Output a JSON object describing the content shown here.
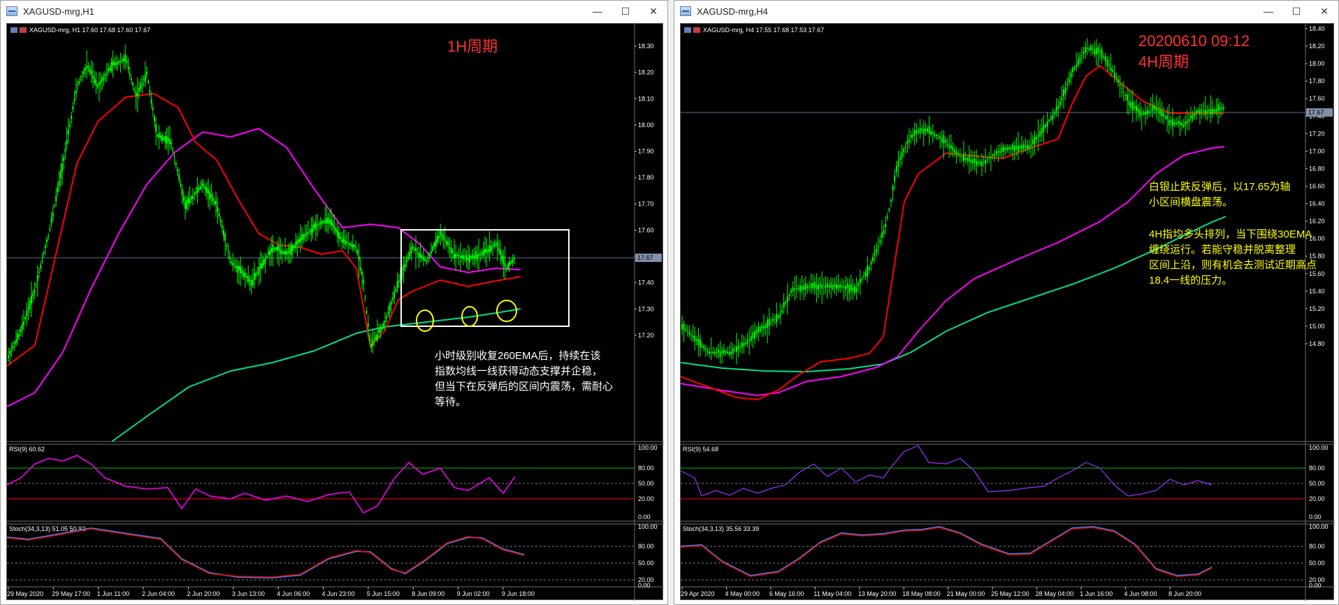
{
  "windows": [
    {
      "title": "XAGUSD-mrg,H1",
      "quote": "XAGUSD-mrg, H1  17.60 17.68 17.60 17.67",
      "period_label": "1H周期",
      "current_price_label": "17.67",
      "price_ticks": [
        "18.30",
        "18.20",
        "18.10",
        "18.00",
        "17.90",
        "17.80",
        "17.70",
        "17.60",
        "17.50",
        "17.40",
        "17.30",
        "17.20"
      ],
      "rsi_label": "RSI(9) 60.62",
      "rsi_ticks": [
        "100.00",
        "80.00",
        "50.00",
        "20.00",
        "0.00"
      ],
      "stoch_label": "Stoch(34,3,13) 51.05 50.92",
      "stoch_ticks": [
        "100.00",
        "80.00",
        "50.00",
        "20.00",
        "0.00"
      ],
      "time_ticks": [
        "29 May 2020",
        "29 May 17:00",
        "1 Jun 11:00",
        "2 Jun 04:00",
        "2 Jun 20:00",
        "3 Jun 13:00",
        "4 Jun 06:00",
        "4 Jun 23:00",
        "5 Jun 15:00",
        "8 Jun 09:00",
        "9 Jun 02:00",
        "9 Jun 18:00"
      ],
      "annotation": [
        "小时级别收复260EMA后，持续在该",
        "指数均线一线获得动态支撑并企稳，",
        "但当下在反弹后的区间内震荡，需耐心",
        "等待。"
      ]
    },
    {
      "title": "XAGUSD-mrg,H4",
      "quote": "XAGUSD-mrg, H4  17.55 17.68 17.53 17.67",
      "date_label": "20200610 09:12",
      "period_label": "4H周期",
      "current_price_label": "17.67",
      "price_ticks": [
        "18.40",
        "18.20",
        "18.00",
        "17.80",
        "17.60",
        "17.40",
        "17.20",
        "17.00",
        "16.80",
        "16.60",
        "16.40",
        "16.20",
        "16.00",
        "15.80",
        "15.60",
        "15.40",
        "15.20",
        "15.00",
        "14.80"
      ],
      "rsi_label": "RSI(9) 54.68",
      "rsi_ticks": [
        "100.00",
        "80.00",
        "50.00",
        "20.00",
        "0.00"
      ],
      "stoch_label": "Stoch(34,3,13) 35.56 33.39",
      "stoch_ticks": [
        "100.00",
        "80.00",
        "50.00",
        "20.00",
        "0.00"
      ],
      "time_ticks": [
        "29 Apr 2020",
        "4 May 00:00",
        "6 May 16:00",
        "11 May 04:00",
        "13 May 20:00",
        "18 May 08:00",
        "21 May 00:00",
        "25 May 12:00",
        "28 May 04:00",
        "1 Jun 16:00",
        "4 Jun 08:00",
        "8 Jun 20:00"
      ],
      "annotation_1": [
        "白银止跌反弹后，以17.65为轴",
        "小区间横盘震荡。"
      ],
      "annotation_2": [
        "4H指均多头排列，当下围绕30EMA",
        "缠绕运行。若能守稳并脱离整理",
        "区间上沿，则有机会去测试近期高点",
        "18.4一线的压力。"
      ]
    }
  ],
  "colors": {
    "candles": "#00ff00",
    "ema_fast": "#ff0000",
    "ema_mid": "#ff00ff",
    "ema_slow": "#00e08a",
    "red_text": "#ff3030",
    "yellow_text": "#ffff00",
    "white_text": "#ffffff",
    "rsi_h1": "#ff00ff",
    "rsi_h4": "#9933ff"
  }
}
